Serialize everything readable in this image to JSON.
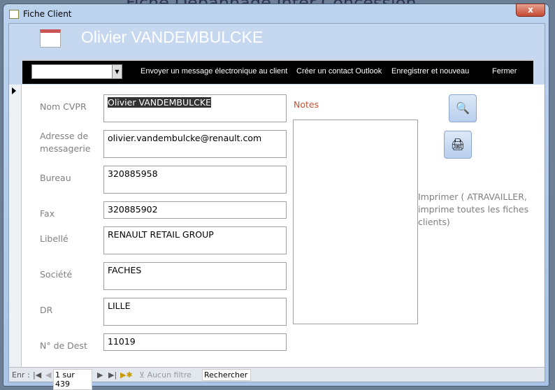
{
  "background_title": "Fiche Dépannage Inter Concession",
  "window": {
    "title": "Fiche Client",
    "close": "x"
  },
  "header": {
    "title": "Olivier VANDEMBULCKE"
  },
  "toolbar": {
    "combo_value": "",
    "send_email": "Envoyer un message électronique au client",
    "outlook": "Créer un contact Outlook",
    "save_new": "Enregistrer et nouveau",
    "close": "Fermer"
  },
  "fields": [
    {
      "label": "Nom CVPR",
      "value": "Olivier VANDEMBULCKE"
    },
    {
      "label": "Adresse de messagerie",
      "value": "olivier.vandembulcke@renault.com"
    },
    {
      "label": "Bureau",
      "value": "320885958"
    },
    {
      "label": "Fax",
      "value": "320885902"
    },
    {
      "label": "Libellé",
      "value": "RENAULT RETAIL GROUP"
    },
    {
      "label": "Société",
      "value": "FACHES"
    },
    {
      "label": "DR",
      "value": "LILLE"
    },
    {
      "label": "N° de Dest",
      "value": "11019"
    }
  ],
  "notes": {
    "label": "Notes",
    "value": ""
  },
  "print_text": "Imprimer ( ATRAVAILLER, imprime toutes les fiches clients)",
  "nav": {
    "label": "Enr :",
    "current": "1 sur 439",
    "filter": "Aucun filtre",
    "search": "Rechercher"
  }
}
